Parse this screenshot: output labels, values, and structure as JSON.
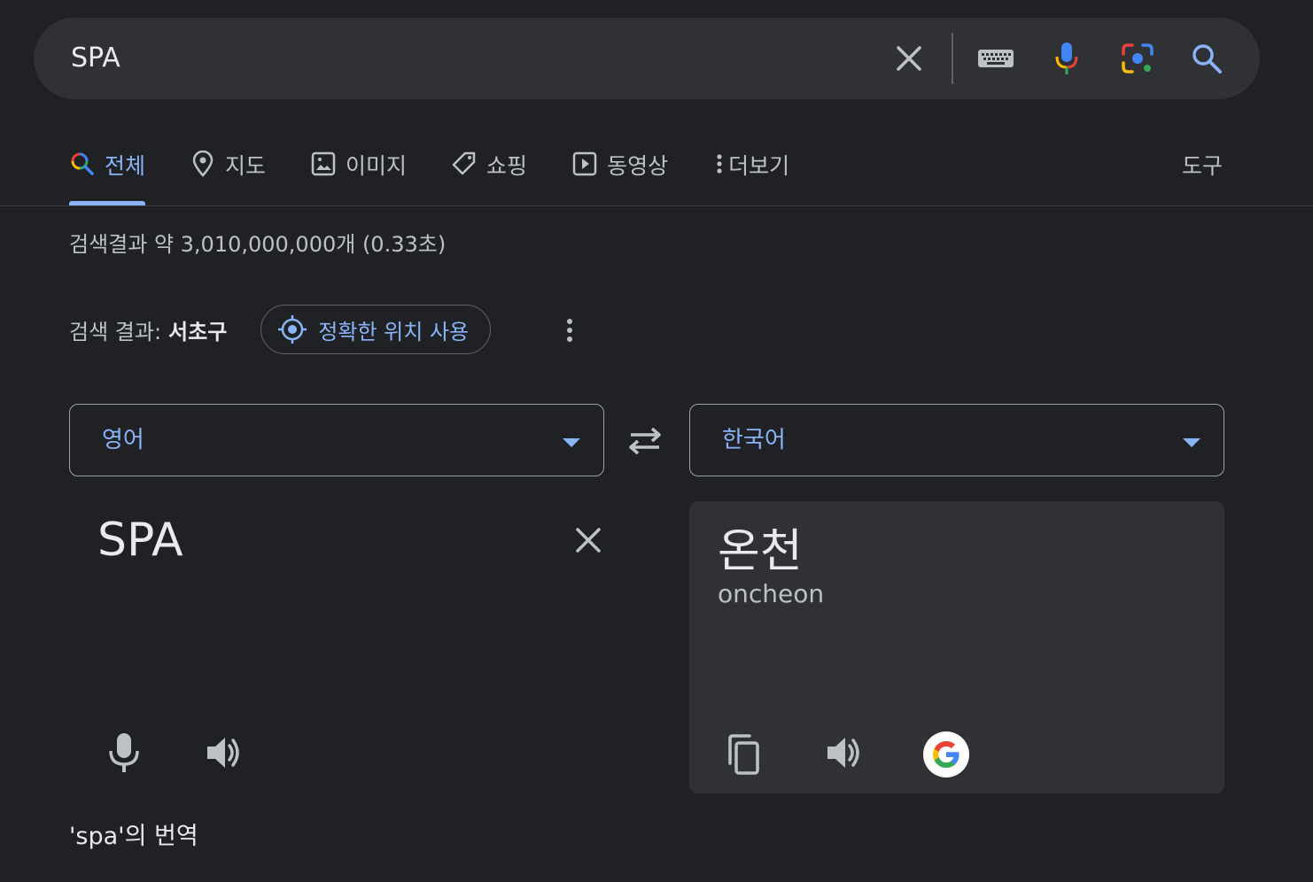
{
  "search": {
    "query": "SPA"
  },
  "icons": {
    "clear": "close-icon",
    "keyboard": "keyboard-icon",
    "mic": "mic-icon",
    "lens": "google-lens-icon",
    "search": "search-icon"
  },
  "tabs": [
    {
      "label": "전체",
      "icon": "search-icon",
      "active": true
    },
    {
      "label": "지도",
      "icon": "map-pin-icon",
      "active": false
    },
    {
      "label": "이미지",
      "icon": "image-icon",
      "active": false
    },
    {
      "label": "쇼핑",
      "icon": "tag-icon",
      "active": false
    },
    {
      "label": "동영상",
      "icon": "play-icon",
      "active": false
    },
    {
      "label": "더보기",
      "icon": "more-vert-icon",
      "active": false
    }
  ],
  "tools_label": "도구",
  "results_count": "검색결과 약 3,010,000,000개 (0.33초)",
  "location": {
    "label": "검색 결과:",
    "value": "서초구",
    "precise_button": "정확한 위치 사용"
  },
  "translator": {
    "source_lang": "영어",
    "target_lang": "한국어",
    "source_text": "SPA",
    "target_text": "온천",
    "romanization": "oncheon",
    "footer": "'spa'의 번역"
  },
  "colors": {
    "background": "#202124",
    "surface": "#303134",
    "accent": "#8ab4f8",
    "text": "#e8eaed",
    "muted": "#bdc1c6"
  }
}
